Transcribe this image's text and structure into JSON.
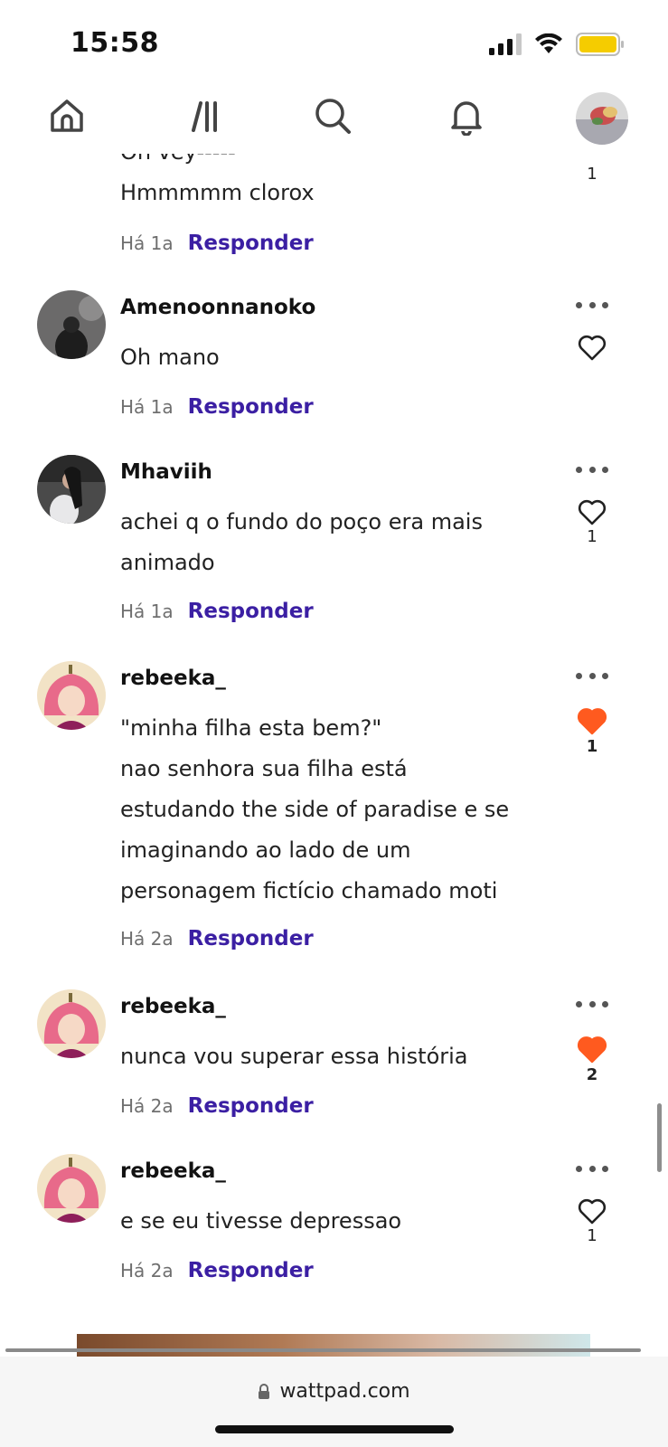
{
  "status_bar": {
    "time": "15:58"
  },
  "nav": {
    "items": [
      {
        "icon": "home-icon"
      },
      {
        "icon": "library-icon"
      },
      {
        "icon": "search-icon"
      },
      {
        "icon": "bell-icon"
      },
      {
        "icon": "profile-avatar"
      }
    ]
  },
  "comments": [
    {
      "user": "",
      "text": "Oh vey-----\nHmmmmm clorox",
      "time": "Há 1a",
      "reply": "Responder",
      "likes": "1",
      "liked": false
    },
    {
      "user": "Amenoonnanoko",
      "text": "Oh mano",
      "time": "Há 1a",
      "reply": "Responder",
      "likes": "",
      "liked": false
    },
    {
      "user": "Mhaviih",
      "text": "achei q o fundo do poço era mais\nanimado",
      "time": "Há 1a",
      "reply": "Responder",
      "likes": "1",
      "liked": false
    },
    {
      "user": "rebeeka_",
      "text": "\"minha filha esta bem?\"\nnao senhora sua filha está\nestudando the side of paradise e se\nimaginando ao lado de um\npersonagem fictício chamado moti",
      "time": "Há 2a",
      "reply": "Responder",
      "likes": "1",
      "liked": true
    },
    {
      "user": "rebeeka_",
      "text": "nunca vou superar essa história",
      "time": "Há 2a",
      "reply": "Responder",
      "likes": "2",
      "liked": true
    },
    {
      "user": "rebeeka_",
      "text": "e se eu tivesse depressao",
      "time": "Há 2a",
      "reply": "Responder",
      "likes": "1",
      "liked": false
    }
  ],
  "browser": {
    "url": "wattpad.com"
  },
  "colors": {
    "reply": "#3b1fa3",
    "liked": "#ff5a1f",
    "accent_text": "#121212"
  }
}
